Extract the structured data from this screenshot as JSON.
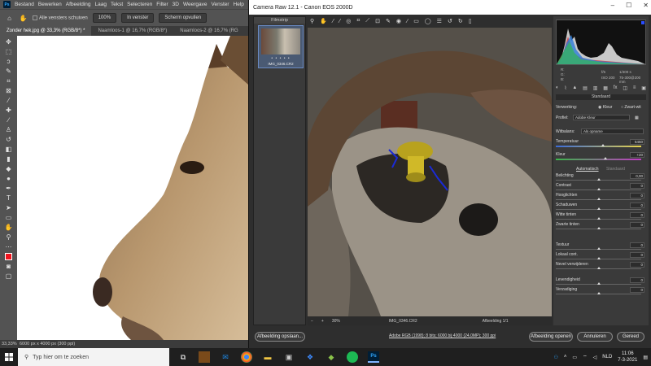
{
  "photoshop": {
    "menu": [
      "Bestand",
      "Bewerken",
      "Afbeelding",
      "Laag",
      "Tekst",
      "Selecteren",
      "Filter",
      "3D",
      "Weergave",
      "Venster",
      "Help"
    ],
    "logo_text": "Ps",
    "options": {
      "scroll_all_label": "Alle vensters schuiven",
      "zoom_100": "100%",
      "fit_screen": "In venster",
      "fill_screen": "Scherm opvullen"
    },
    "tabs": [
      "Zonder hek.jpg @ 33,3% (RGB/8*) *",
      "Naamloos-1 @ 16,7% (RGB/8*)",
      "Naamloos-2 @ 16,7% (RG"
    ],
    "status": {
      "zoom": "33,33%",
      "doc_size": "6000 px x 4000 px (300 ppi)"
    },
    "fg_color": "#f0141e"
  },
  "camera_raw": {
    "title": "Camera Raw 12.1  -  Canon EOS 2000D",
    "filmstrip": {
      "header": "Filmstrip",
      "stars": "• • • • •",
      "file": "IMG_0346.CR2"
    },
    "canvas_bar": {
      "zoom": "30%",
      "file": "IMG_0346.CR2",
      "counter": "Afbeelding 1/1"
    },
    "info": {
      "r": "R:",
      "g": "G:",
      "b": "B:",
      "aperture": "f/5",
      "shutter": "1/400 s",
      "iso": "ISO 200",
      "lens": "75-300@200 mm"
    },
    "panel": {
      "title": "Standaard",
      "treatment_label": "Verwerking:",
      "treatment_color": "Kleur",
      "treatment_bw": "Zwart-wit",
      "profile_label": "Profiel:",
      "profile_value": "Adobe Kleur",
      "wb_label": "Witbalans:",
      "wb_value": "Als opname",
      "auto": "Automatisch",
      "default": "Standaard",
      "sliders": [
        {
          "label": "Temperatuur",
          "value": "5450"
        },
        {
          "label": "Kleur",
          "value": "+20"
        },
        {
          "label": "Belichting",
          "value": "0,00"
        },
        {
          "label": "Contrast",
          "value": "0"
        },
        {
          "label": "Hooglichten",
          "value": "0"
        },
        {
          "label": "Schaduwen",
          "value": "0"
        },
        {
          "label": "Witte tinten",
          "value": "0"
        },
        {
          "label": "Zwarte tinten",
          "value": "0"
        },
        {
          "label": "Textuur",
          "value": "0"
        },
        {
          "label": "Lokaal cont.",
          "value": "0"
        },
        {
          "label": "Nevel verwijderen",
          "value": "0"
        },
        {
          "label": "Levendigheid",
          "value": "0"
        },
        {
          "label": "Verzadiging",
          "value": "0"
        }
      ]
    },
    "bottom": {
      "save": "Afbeelding opslaan...",
      "workflow": "Adobe RGB (1998); 8 bits; 6000 bij 4000 (24,0MP); 300 ppi",
      "open": "Afbeelding openen",
      "cancel": "Annuleren",
      "done": "Gereed"
    }
  },
  "taskbar": {
    "search_placeholder": "Typ hier om te zoeken",
    "lang": "NLD",
    "time": "11:06",
    "date": "7-3-2021"
  }
}
